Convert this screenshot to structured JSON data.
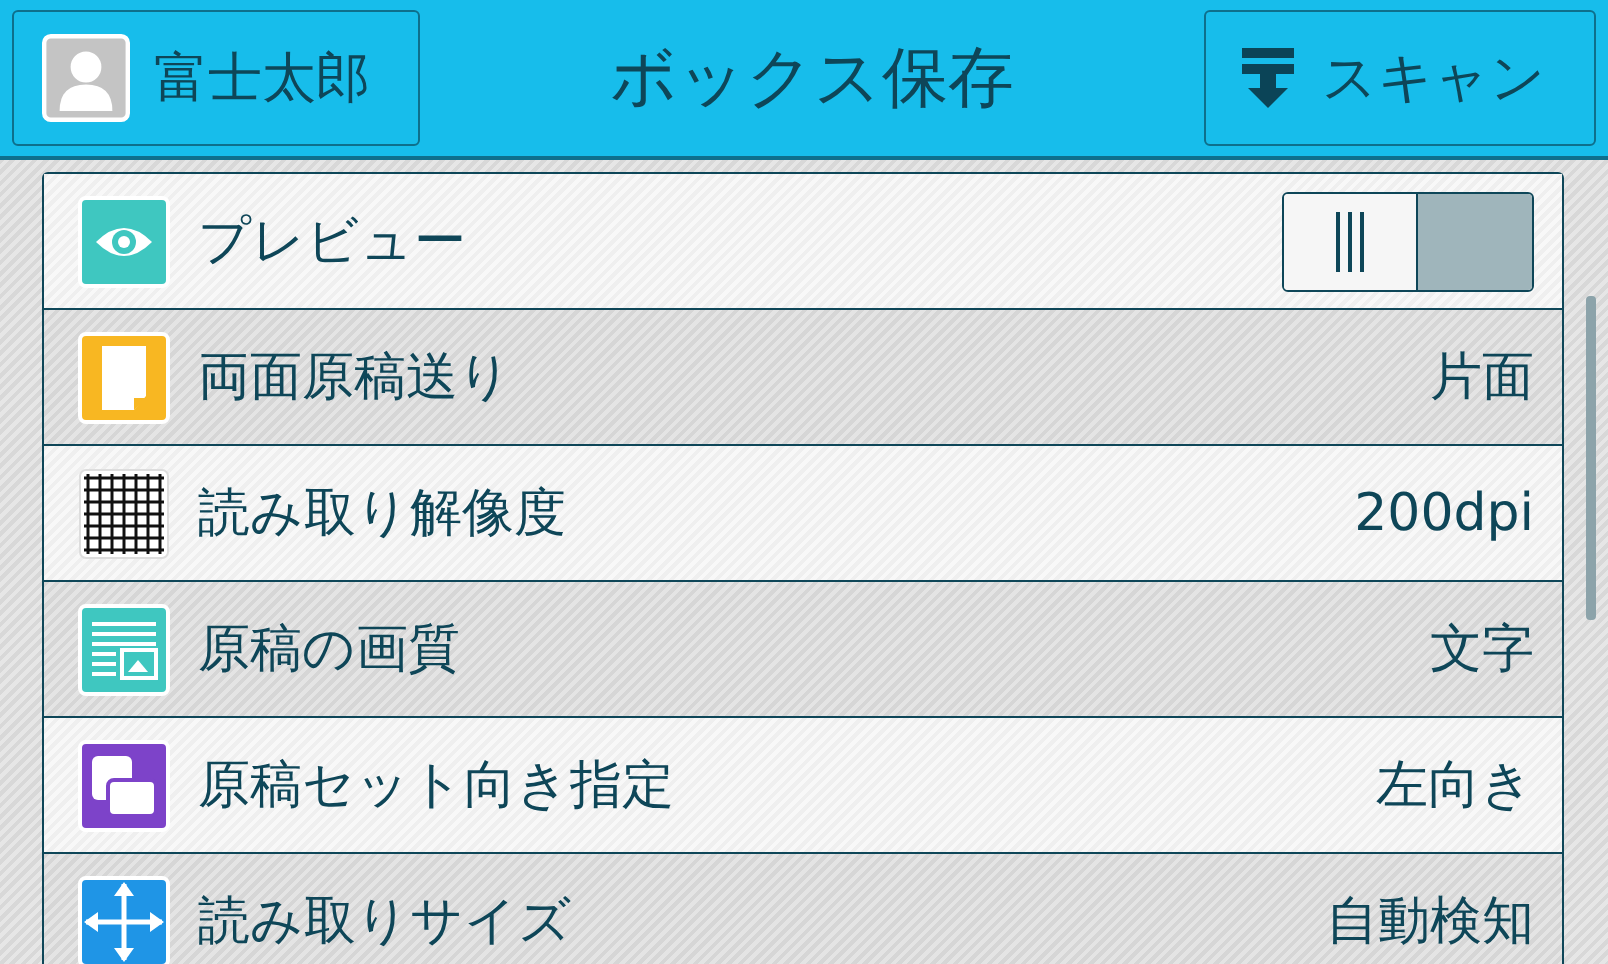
{
  "header": {
    "user": "富士太郎",
    "title": "ボックス保存",
    "scan_button": "スキャン"
  },
  "settings": [
    {
      "kind": "toggle",
      "label": "プレビュー",
      "on": false
    },
    {
      "kind": "value",
      "label": "両面原稿送り",
      "value": "片面"
    },
    {
      "kind": "value",
      "label": "読み取り解像度",
      "value": "200dpi"
    },
    {
      "kind": "value",
      "label": "原稿の画質",
      "value": "文字"
    },
    {
      "kind": "value",
      "label": "原稿セット向き指定",
      "value": "左向き"
    },
    {
      "kind": "value",
      "label": "読み取りサイズ",
      "value": "自動検知"
    }
  ]
}
